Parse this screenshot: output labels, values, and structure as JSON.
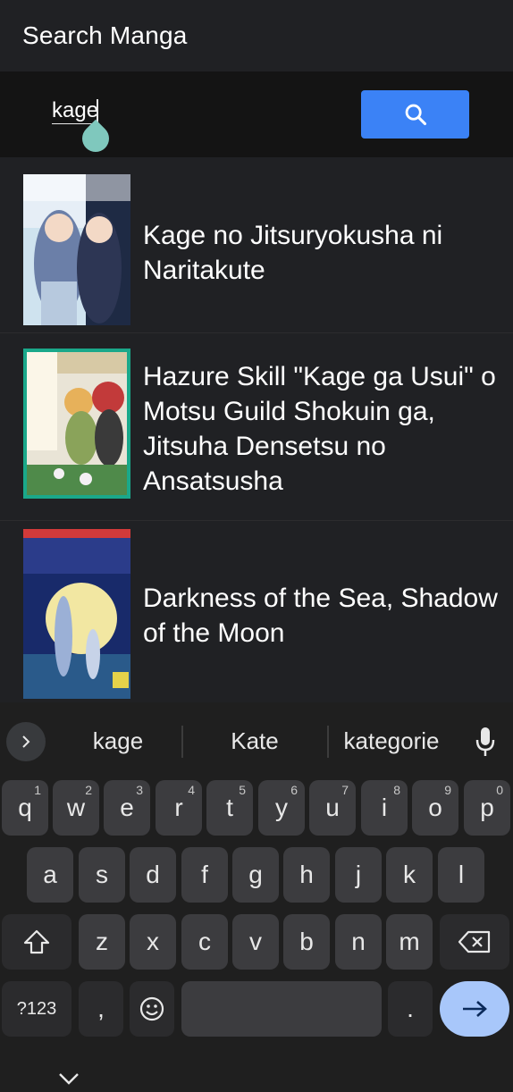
{
  "appbar": {
    "title": "Search Manga"
  },
  "search": {
    "value": "kage",
    "button_icon": "search-icon"
  },
  "results": [
    {
      "title": "Kage no Jitsuryokusha ni Naritakute"
    },
    {
      "title": "Hazure Skill \"Kage ga Usui\" o Motsu Guild Shokuin ga, Jitsuha Densetsu no Ansatsusha"
    },
    {
      "title": "Darkness of the Sea, Shadow of the Moon"
    }
  ],
  "keyboard": {
    "suggestions": [
      "kage",
      "Kate",
      "kategorie"
    ],
    "row1": [
      {
        "k": "q",
        "h": "1"
      },
      {
        "k": "w",
        "h": "2"
      },
      {
        "k": "e",
        "h": "3"
      },
      {
        "k": "r",
        "h": "4"
      },
      {
        "k": "t",
        "h": "5"
      },
      {
        "k": "y",
        "h": "6"
      },
      {
        "k": "u",
        "h": "7"
      },
      {
        "k": "i",
        "h": "8"
      },
      {
        "k": "o",
        "h": "9"
      },
      {
        "k": "p",
        "h": "0"
      }
    ],
    "row2": [
      "a",
      "s",
      "d",
      "f",
      "g",
      "h",
      "j",
      "k",
      "l"
    ],
    "row3": [
      "z",
      "x",
      "c",
      "v",
      "b",
      "n",
      "m"
    ],
    "symbols_label": "?123",
    "comma": ",",
    "period": "."
  },
  "colors": {
    "accent": "#3b82f6",
    "background": "#202124",
    "enter": "#a8c7fa"
  }
}
